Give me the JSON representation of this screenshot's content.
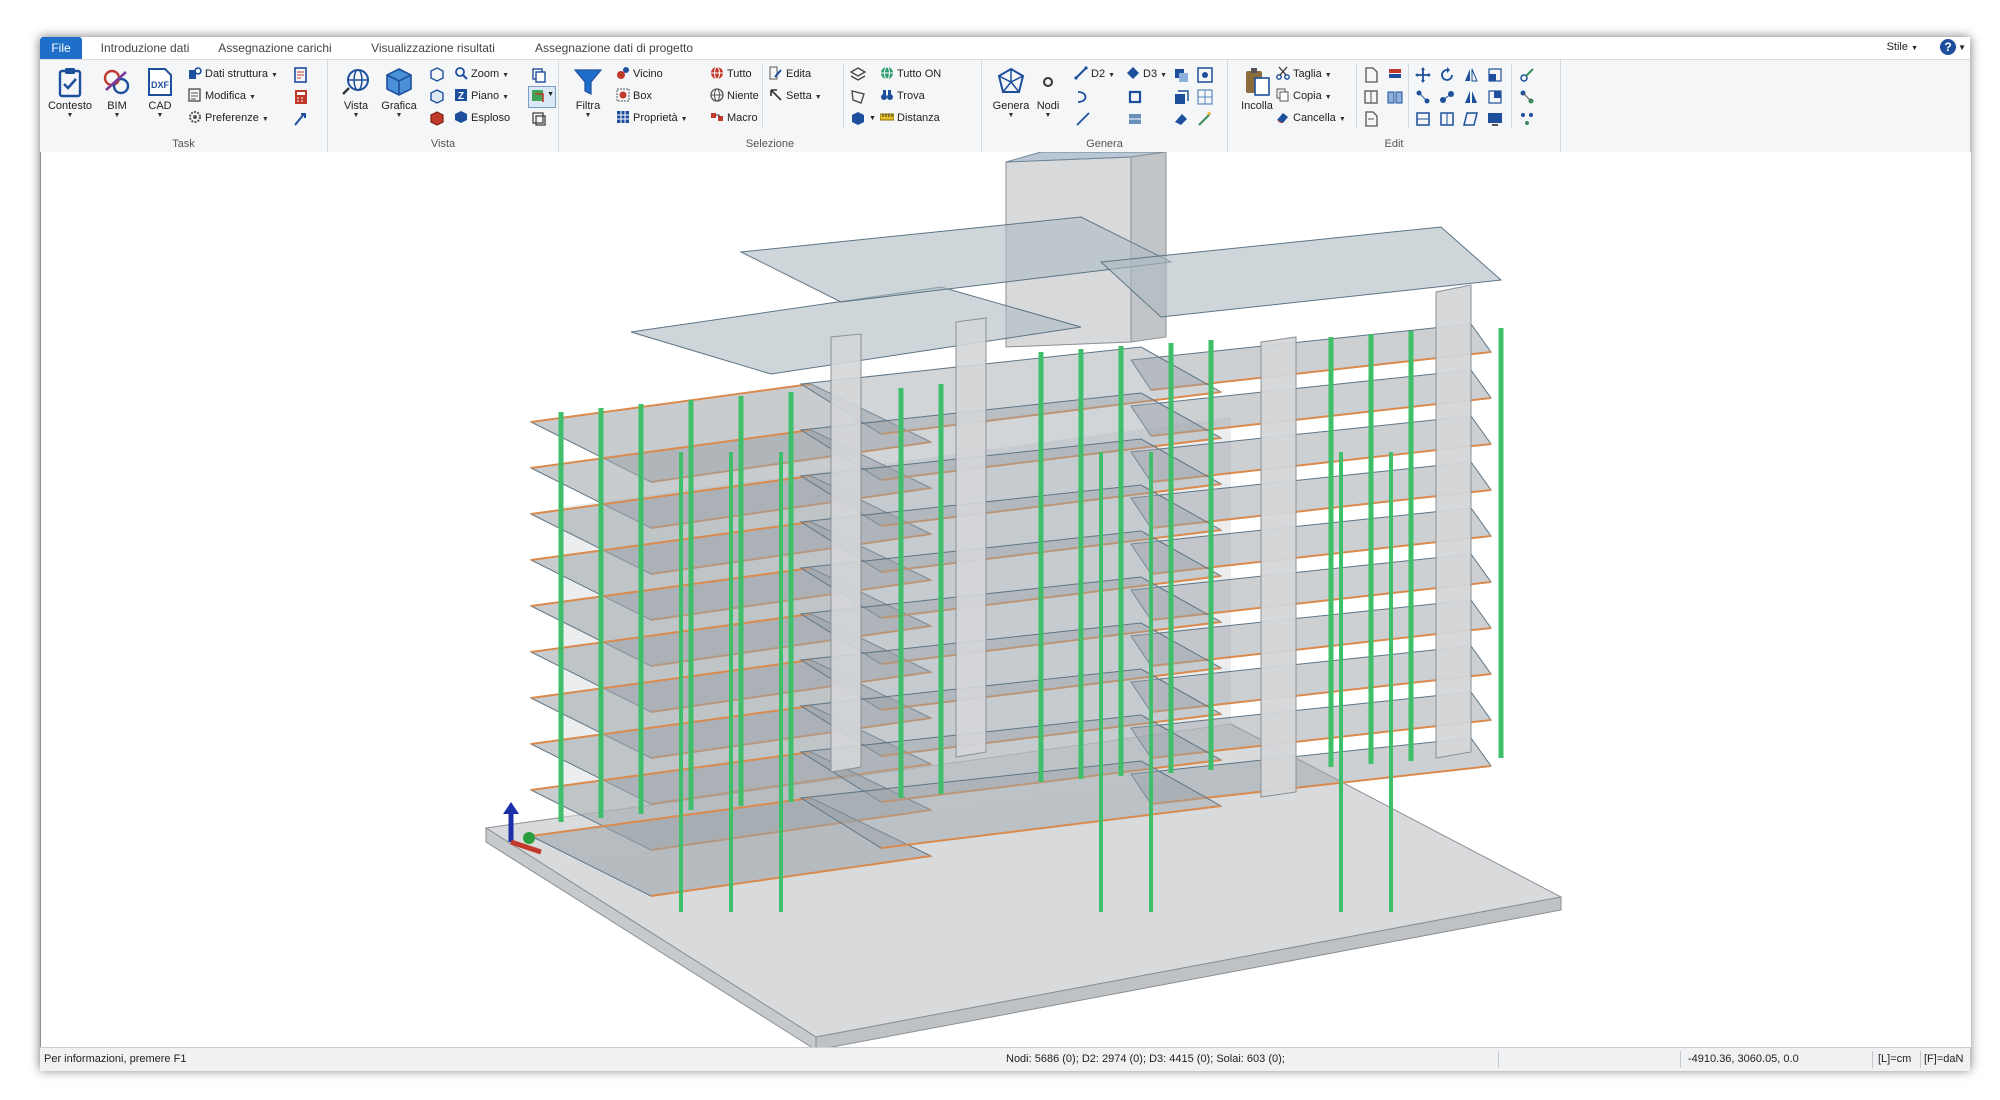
{
  "tabs": [
    "File",
    "Introduzione dati",
    "Assegnazione carichi",
    "Visualizzazione risultati",
    "Assegnazione dati di progetto"
  ],
  "top_right": {
    "style_label": "Stile",
    "help_icon": "question-icon"
  },
  "ribbon": {
    "task": {
      "label": "Task",
      "contesto": "Contesto",
      "bim": "BIM",
      "cad": "CAD",
      "dati_struttura": "Dati struttura",
      "modifica": "Modifica",
      "preferenze": "Preferenze"
    },
    "vista": {
      "label": "Vista",
      "vista": "Vista",
      "grafica": "Grafica",
      "zoom": "Zoom",
      "piano": "Piano",
      "esploso": "Esploso"
    },
    "selezione": {
      "label": "Selezione",
      "filtra": "Filtra",
      "vicino": "Vicino",
      "box": "Box",
      "proprieta": "Proprietà",
      "tutto": "Tutto",
      "niente": "Niente",
      "macro": "Macro",
      "edita": "Edita",
      "setta": "Setta",
      "tutto_on": "Tutto ON",
      "trova": "Trova",
      "distanza": "Distanza"
    },
    "genera": {
      "label": "Genera",
      "genera": "Genera",
      "nodi": "Nodi",
      "d2": "D2",
      "d3": "D3"
    },
    "edit": {
      "label": "Edit",
      "incolla": "Incolla",
      "taglia": "Taglia",
      "copia": "Copia",
      "cancella": "Cancella"
    }
  },
  "status": {
    "help": "Per informazioni, premere F1",
    "counts": "Nodi: 5686 (0); D2: 2974 (0); D3: 4415 (0); Solai: 603 (0);",
    "coords": "-4910.36, 3060.05, 0.0",
    "length_unit": "[L]=cm",
    "force_unit": "[F]=daN"
  },
  "colors": {
    "tab_active": "#1d6fc9",
    "column_green": "#3fbf6a",
    "beam_orange": "#d98a4f",
    "slab_grey": "#9aa2a8",
    "wall_grey": "#d4d6d8"
  }
}
